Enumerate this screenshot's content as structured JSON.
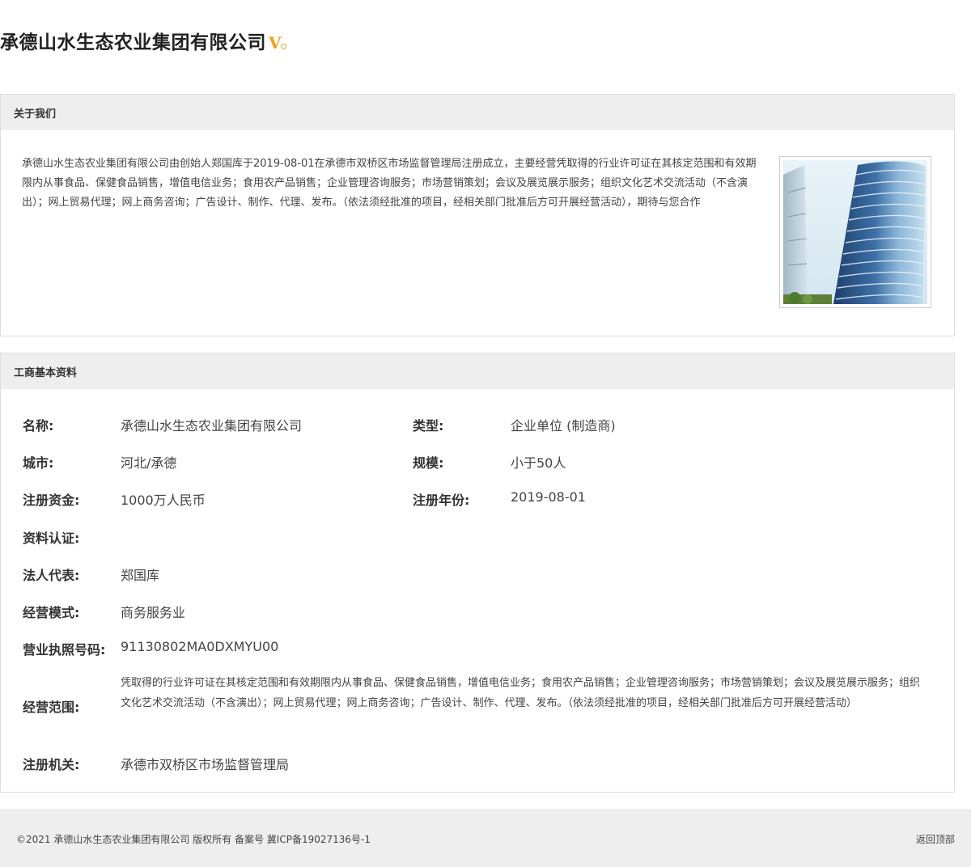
{
  "company": {
    "name": "承德山水生态农业集团有限公司",
    "verified_badge": "V"
  },
  "about": {
    "title": "关于我们",
    "description": "承德山水生态农业集团有限公司由创始人郑国库于2019-08-01在承德市双桥区市场监督管理局注册成立，主要经营凭取得的行业许可证在其核定范围和有效期限内从事食品、保健食品销售，增值电信业务；食用农产品销售；企业管理咨询服务；市场营销策划；会议及展览展示服务；组织文化艺术交流活动（不含演出）；网上贸易代理；网上商务咨询；广告设计、制作、代理、发布。（依法须经批准的项目，经相关部门批准后方可开展经营活动），期待与您合作",
    "photo_icon": "office-building-photo"
  },
  "business_info": {
    "title": "工商基本资料",
    "name_label": "名称:",
    "name_value": "承德山水生态农业集团有限公司",
    "type_label": "类型:",
    "type_value": "企业单位 (制造商)",
    "city_label": "城市:",
    "city_value": "河北/承德",
    "scale_label": "规模:",
    "scale_value": "小于50人",
    "capital_label": "注册资金:",
    "capital_value": "1000万人民币",
    "reg_year_label": "注册年份:",
    "reg_year_value": "2019-08-01",
    "cert_label": "资料认证:",
    "cert_value": "",
    "legal_rep_label": "法人代表:",
    "legal_rep_value": "郑国库",
    "mode_label": "经营模式:",
    "mode_value": "商务服务业",
    "license_label": "营业执照号码:",
    "license_value": "91130802MA0DXMYU00",
    "scope_label": "经营范围:",
    "scope_value": "凭取得的行业许可证在其核定范围和有效期限内从事食品、保健食品销售，增值电信业务；食用农产品销售；企业管理咨询服务；市场营销策划；会议及展览展示服务；组织文化艺术交流活动（不含演出）；网上贸易代理；网上商务咨询；广告设计、制作、代理、发布。（依法须经批准的项目，经相关部门批准后方可开展经营活动）",
    "authority_label": "注册机关:",
    "authority_value": "承德市双桥区市场监督管理局"
  },
  "footer": {
    "copyright": "©2021 承德山水生态农业集团有限公司 版权所有 备案号 冀ICP备19027136号-1",
    "back_to_top": "返回顶部"
  },
  "colors": {
    "badge": "#e8a217",
    "panel_header_bg": "#eeeeee",
    "border": "#dddddd"
  }
}
